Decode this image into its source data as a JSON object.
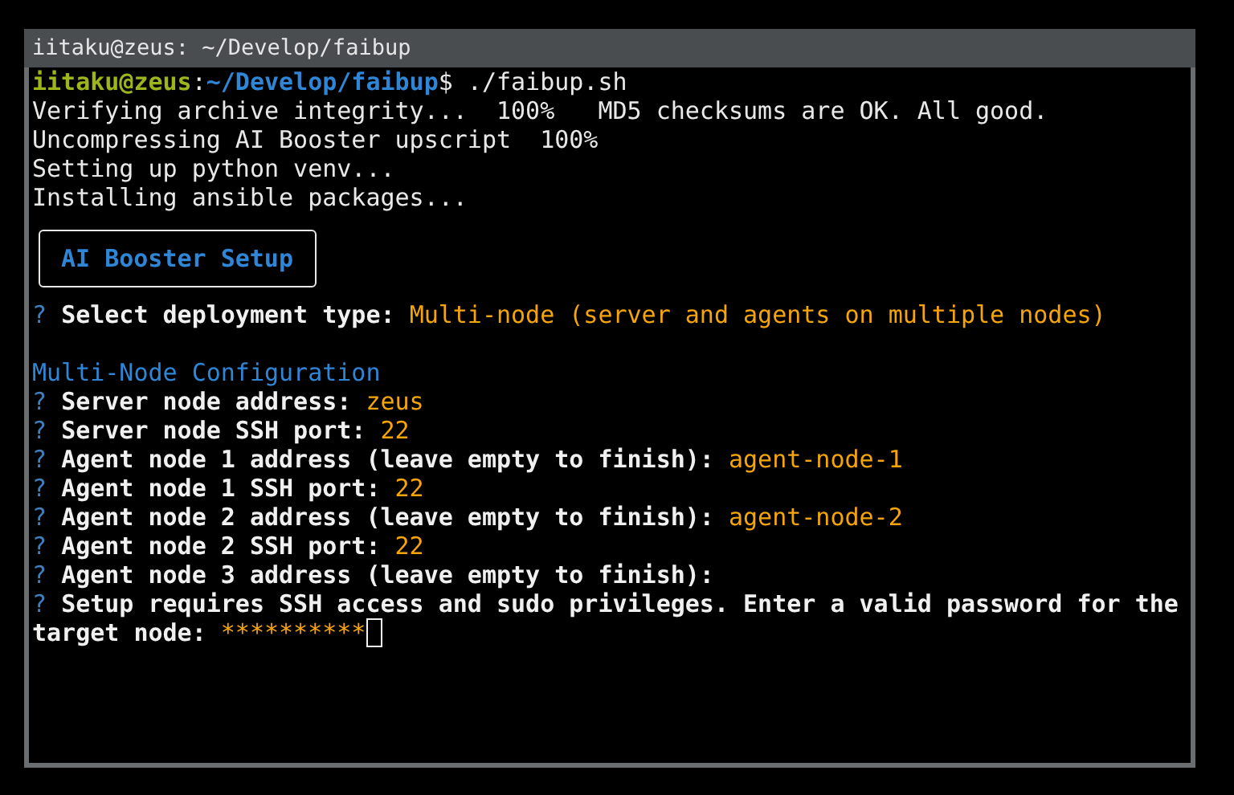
{
  "window": {
    "title": "iitaku@zeus: ~/Develop/faibup"
  },
  "lines": [
    {
      "kind": "prompt",
      "user": "iitaku@zeus",
      "separator": ":",
      "path": "~/Develop/faibup",
      "command": "$ ./faibup.sh"
    },
    {
      "kind": "output",
      "text": "Verifying archive integrity...  100%   MD5 checksums are OK. All good."
    },
    {
      "kind": "output",
      "text": "Uncompressing AI Booster upscript  100%"
    },
    {
      "kind": "output",
      "text": "Setting up python venv..."
    },
    {
      "kind": "output",
      "text": "Installing ansible packages..."
    },
    {
      "kind": "banner",
      "text": "AI Booster Setup"
    },
    {
      "kind": "question",
      "mark": "?",
      "label": "Select deployment type:",
      "value": "Multi-node (server and agents on multiple nodes)"
    },
    {
      "kind": "blank"
    },
    {
      "kind": "heading",
      "text": "Multi-Node Configuration"
    },
    {
      "kind": "question",
      "mark": "?",
      "label": "Server node address:",
      "value": "zeus"
    },
    {
      "kind": "question",
      "mark": "?",
      "label": "Server node SSH port:",
      "value": "22"
    },
    {
      "kind": "question",
      "mark": "?",
      "label": "Agent node 1 address (leave empty to finish):",
      "value": "agent-node-1"
    },
    {
      "kind": "question",
      "mark": "?",
      "label": "Agent node 1 SSH port:",
      "value": "22"
    },
    {
      "kind": "question",
      "mark": "?",
      "label": "Agent node 2 address (leave empty to finish):",
      "value": "agent-node-2"
    },
    {
      "kind": "question",
      "mark": "?",
      "label": "Agent node 2 SSH port:",
      "value": "22"
    },
    {
      "kind": "question",
      "mark": "?",
      "label": "Agent node 3 address (leave empty to finish):"
    },
    {
      "kind": "question",
      "mark": "?",
      "label": "Setup requires SSH access and sudo privileges. Enter a valid password for the"
    },
    {
      "kind": "continuation",
      "label": "target node:",
      "value": "**********",
      "cursor": true
    }
  ]
}
